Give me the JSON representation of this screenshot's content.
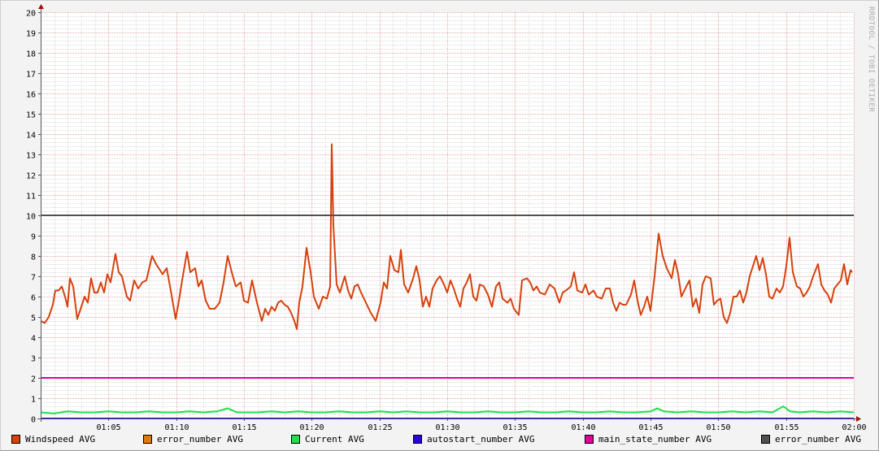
{
  "chart_data": {
    "type": "line",
    "title": "",
    "xlabel": "",
    "ylabel": "",
    "x_unit": "minutes after 01:00",
    "xlim": [
      0,
      60
    ],
    "ylim": [
      0,
      20
    ],
    "y_ticks": [
      0,
      1,
      2,
      3,
      4,
      5,
      6,
      7,
      8,
      9,
      10,
      11,
      12,
      13,
      14,
      15,
      16,
      17,
      18,
      19,
      20
    ],
    "x_ticks": [
      {
        "t": 5,
        "label": "01:05"
      },
      {
        "t": 10,
        "label": "01:10"
      },
      {
        "t": 15,
        "label": "01:15"
      },
      {
        "t": 20,
        "label": "01:20"
      },
      {
        "t": 25,
        "label": "01:25"
      },
      {
        "t": 30,
        "label": "01:30"
      },
      {
        "t": 35,
        "label": "01:35"
      },
      {
        "t": 40,
        "label": "01:40"
      },
      {
        "t": 45,
        "label": "01:45"
      },
      {
        "t": 50,
        "label": "01:50"
      },
      {
        "t": 55,
        "label": "01:55"
      },
      {
        "t": 60,
        "label": "02:00"
      }
    ],
    "grid": true,
    "legend_position": "bottom",
    "watermark": "RRDTOOL / TOBI OETIKER",
    "series": [
      {
        "name": "Windspeed AVG",
        "color": "#d8400c",
        "points": [
          [
            0,
            4.8
          ],
          [
            0.3,
            4.7
          ],
          [
            0.6,
            5.0
          ],
          [
            0.9,
            5.6
          ],
          [
            1.08,
            6.3
          ],
          [
            1.32,
            6.3
          ],
          [
            1.56,
            6.5
          ],
          [
            1.8,
            6.0
          ],
          [
            1.98,
            5.5
          ],
          [
            2.16,
            6.9
          ],
          [
            2.4,
            6.5
          ],
          [
            2.7,
            4.9
          ],
          [
            3.0,
            5.5
          ],
          [
            3.24,
            6.0
          ],
          [
            3.48,
            5.7
          ],
          [
            3.72,
            6.9
          ],
          [
            3.96,
            6.2
          ],
          [
            4.2,
            6.2
          ],
          [
            4.44,
            6.7
          ],
          [
            4.68,
            6.2
          ],
          [
            4.92,
            7.1
          ],
          [
            5.16,
            6.7
          ],
          [
            5.52,
            8.1
          ],
          [
            5.76,
            7.2
          ],
          [
            6.0,
            7.0
          ],
          [
            6.36,
            6.0
          ],
          [
            6.6,
            5.8
          ],
          [
            6.9,
            6.8
          ],
          [
            7.2,
            6.4
          ],
          [
            7.5,
            6.7
          ],
          [
            7.8,
            6.8
          ],
          [
            8.22,
            8.0
          ],
          [
            8.52,
            7.6
          ],
          [
            9.0,
            7.1
          ],
          [
            9.3,
            7.4
          ],
          [
            9.6,
            6.3
          ],
          [
            9.96,
            4.9
          ],
          [
            10.2,
            5.8
          ],
          [
            10.44,
            6.8
          ],
          [
            10.8,
            8.2
          ],
          [
            11.04,
            7.2
          ],
          [
            11.4,
            7.4
          ],
          [
            11.64,
            6.5
          ],
          [
            11.88,
            6.8
          ],
          [
            12.18,
            5.8
          ],
          [
            12.48,
            5.4
          ],
          [
            12.84,
            5.4
          ],
          [
            13.2,
            5.7
          ],
          [
            13.5,
            6.7
          ],
          [
            13.8,
            8.0
          ],
          [
            14.1,
            7.2
          ],
          [
            14.4,
            6.5
          ],
          [
            14.76,
            6.7
          ],
          [
            15.0,
            5.8
          ],
          [
            15.3,
            5.7
          ],
          [
            15.6,
            6.8
          ],
          [
            15.96,
            5.7
          ],
          [
            16.32,
            4.8
          ],
          [
            16.56,
            5.4
          ],
          [
            16.8,
            5.1
          ],
          [
            17.04,
            5.5
          ],
          [
            17.28,
            5.3
          ],
          [
            17.52,
            5.7
          ],
          [
            17.76,
            5.8
          ],
          [
            18.0,
            5.6
          ],
          [
            18.24,
            5.5
          ],
          [
            18.48,
            5.2
          ],
          [
            18.72,
            4.8
          ],
          [
            18.9,
            4.4
          ],
          [
            19.08,
            5.7
          ],
          [
            19.32,
            6.5
          ],
          [
            19.62,
            8.4
          ],
          [
            19.92,
            7.2
          ],
          [
            20.16,
            6.0
          ],
          [
            20.52,
            5.4
          ],
          [
            20.82,
            6.0
          ],
          [
            21.12,
            5.9
          ],
          [
            21.36,
            6.5
          ],
          [
            21.48,
            13.5
          ],
          [
            21.6,
            9.5
          ],
          [
            21.84,
            6.6
          ],
          [
            22.08,
            6.2
          ],
          [
            22.44,
            7.0
          ],
          [
            22.68,
            6.3
          ],
          [
            22.92,
            5.9
          ],
          [
            23.16,
            6.5
          ],
          [
            23.4,
            6.6
          ],
          [
            23.64,
            6.2
          ],
          [
            24.0,
            5.7
          ],
          [
            24.36,
            5.2
          ],
          [
            24.72,
            4.8
          ],
          [
            25.08,
            5.7
          ],
          [
            25.32,
            6.7
          ],
          [
            25.56,
            6.4
          ],
          [
            25.8,
            8.0
          ],
          [
            26.1,
            7.3
          ],
          [
            26.4,
            7.2
          ],
          [
            26.58,
            8.3
          ],
          [
            26.82,
            6.6
          ],
          [
            27.12,
            6.2
          ],
          [
            27.48,
            6.9
          ],
          [
            27.72,
            7.5
          ],
          [
            27.96,
            6.8
          ],
          [
            28.2,
            5.5
          ],
          [
            28.44,
            6.0
          ],
          [
            28.68,
            5.5
          ],
          [
            28.92,
            6.4
          ],
          [
            29.22,
            6.8
          ],
          [
            29.46,
            7.0
          ],
          [
            29.76,
            6.6
          ],
          [
            30.0,
            6.2
          ],
          [
            30.24,
            6.8
          ],
          [
            30.48,
            6.4
          ],
          [
            30.72,
            5.9
          ],
          [
            30.96,
            5.5
          ],
          [
            31.2,
            6.4
          ],
          [
            31.44,
            6.7
          ],
          [
            31.68,
            7.1
          ],
          [
            31.92,
            6.0
          ],
          [
            32.16,
            5.8
          ],
          [
            32.4,
            6.6
          ],
          [
            32.7,
            6.5
          ],
          [
            33.0,
            6.1
          ],
          [
            33.3,
            5.5
          ],
          [
            33.6,
            6.5
          ],
          [
            33.84,
            6.7
          ],
          [
            34.08,
            5.9
          ],
          [
            34.44,
            5.7
          ],
          [
            34.68,
            5.9
          ],
          [
            34.92,
            5.4
          ],
          [
            35.28,
            5.1
          ],
          [
            35.52,
            6.8
          ],
          [
            35.88,
            6.9
          ],
          [
            36.12,
            6.7
          ],
          [
            36.36,
            6.3
          ],
          [
            36.6,
            6.5
          ],
          [
            36.84,
            6.2
          ],
          [
            37.2,
            6.1
          ],
          [
            37.56,
            6.6
          ],
          [
            37.92,
            6.4
          ],
          [
            38.28,
            5.7
          ],
          [
            38.52,
            6.2
          ],
          [
            38.76,
            6.3
          ],
          [
            39.12,
            6.5
          ],
          [
            39.36,
            7.2
          ],
          [
            39.6,
            6.3
          ],
          [
            39.96,
            6.2
          ],
          [
            40.2,
            6.6
          ],
          [
            40.44,
            6.1
          ],
          [
            40.8,
            6.3
          ],
          [
            41.04,
            6.0
          ],
          [
            41.4,
            5.9
          ],
          [
            41.7,
            6.4
          ],
          [
            42.0,
            6.4
          ],
          [
            42.24,
            5.7
          ],
          [
            42.48,
            5.3
          ],
          [
            42.72,
            5.7
          ],
          [
            42.96,
            5.6
          ],
          [
            43.2,
            5.6
          ],
          [
            43.56,
            6.1
          ],
          [
            43.8,
            6.8
          ],
          [
            44.04,
            5.8
          ],
          [
            44.28,
            5.1
          ],
          [
            44.52,
            5.5
          ],
          [
            44.76,
            6.0
          ],
          [
            45.0,
            5.3
          ],
          [
            45.3,
            7.0
          ],
          [
            45.6,
            9.1
          ],
          [
            45.9,
            8.0
          ],
          [
            46.2,
            7.4
          ],
          [
            46.56,
            6.9
          ],
          [
            46.8,
            7.8
          ],
          [
            47.04,
            7.1
          ],
          [
            47.28,
            6.0
          ],
          [
            47.64,
            6.5
          ],
          [
            47.88,
            6.8
          ],
          [
            48.12,
            5.5
          ],
          [
            48.36,
            5.9
          ],
          [
            48.6,
            5.2
          ],
          [
            48.84,
            6.6
          ],
          [
            49.08,
            7.0
          ],
          [
            49.44,
            6.9
          ],
          [
            49.68,
            5.6
          ],
          [
            49.92,
            5.8
          ],
          [
            50.16,
            5.9
          ],
          [
            50.4,
            5.0
          ],
          [
            50.64,
            4.7
          ],
          [
            50.88,
            5.2
          ],
          [
            51.12,
            6.0
          ],
          [
            51.36,
            6.0
          ],
          [
            51.6,
            6.3
          ],
          [
            51.84,
            5.7
          ],
          [
            52.08,
            6.2
          ],
          [
            52.32,
            7.0
          ],
          [
            52.56,
            7.5
          ],
          [
            52.8,
            8.0
          ],
          [
            53.04,
            7.3
          ],
          [
            53.28,
            7.9
          ],
          [
            53.52,
            7.1
          ],
          [
            53.76,
            6.0
          ],
          [
            54.0,
            5.9
          ],
          [
            54.3,
            6.4
          ],
          [
            54.54,
            6.2
          ],
          [
            54.78,
            6.5
          ],
          [
            55.02,
            7.5
          ],
          [
            55.26,
            8.9
          ],
          [
            55.5,
            7.2
          ],
          [
            55.8,
            6.5
          ],
          [
            56.04,
            6.4
          ],
          [
            56.28,
            6.0
          ],
          [
            56.52,
            6.2
          ],
          [
            56.76,
            6.5
          ],
          [
            57.0,
            7.0
          ],
          [
            57.36,
            7.6
          ],
          [
            57.6,
            6.6
          ],
          [
            57.84,
            6.3
          ],
          [
            58.08,
            6.1
          ],
          [
            58.32,
            5.7
          ],
          [
            58.56,
            6.4
          ],
          [
            58.8,
            6.6
          ],
          [
            59.04,
            6.8
          ],
          [
            59.28,
            7.6
          ],
          [
            59.52,
            6.6
          ],
          [
            59.76,
            7.3
          ],
          [
            59.88,
            7.2
          ]
        ]
      },
      {
        "name": "error_number AVG",
        "color": "#e07a00",
        "points": []
      },
      {
        "name": "Current AVG",
        "color": "#1ee04a",
        "points": [
          [
            0,
            0.3
          ],
          [
            1,
            0.25
          ],
          [
            2,
            0.35
          ],
          [
            3,
            0.3
          ],
          [
            4,
            0.3
          ],
          [
            5,
            0.35
          ],
          [
            6,
            0.3
          ],
          [
            7,
            0.3
          ],
          [
            8,
            0.35
          ],
          [
            9,
            0.3
          ],
          [
            10,
            0.3
          ],
          [
            11,
            0.35
          ],
          [
            12,
            0.3
          ],
          [
            13,
            0.35
          ],
          [
            13.8,
            0.5
          ],
          [
            14.5,
            0.3
          ],
          [
            15,
            0.3
          ],
          [
            16,
            0.3
          ],
          [
            17,
            0.35
          ],
          [
            18,
            0.3
          ],
          [
            19,
            0.35
          ],
          [
            20,
            0.3
          ],
          [
            21,
            0.3
          ],
          [
            22,
            0.35
          ],
          [
            23,
            0.3
          ],
          [
            24,
            0.3
          ],
          [
            25,
            0.35
          ],
          [
            26,
            0.3
          ],
          [
            27,
            0.35
          ],
          [
            28,
            0.3
          ],
          [
            29,
            0.3
          ],
          [
            30,
            0.35
          ],
          [
            31,
            0.3
          ],
          [
            32,
            0.3
          ],
          [
            33,
            0.35
          ],
          [
            34,
            0.3
          ],
          [
            35,
            0.3
          ],
          [
            36,
            0.35
          ],
          [
            37,
            0.3
          ],
          [
            38,
            0.3
          ],
          [
            39,
            0.35
          ],
          [
            40,
            0.3
          ],
          [
            41,
            0.3
          ],
          [
            42,
            0.35
          ],
          [
            43,
            0.3
          ],
          [
            44,
            0.3
          ],
          [
            45,
            0.35
          ],
          [
            45.5,
            0.5
          ],
          [
            46,
            0.35
          ],
          [
            47,
            0.3
          ],
          [
            48,
            0.35
          ],
          [
            49,
            0.3
          ],
          [
            50,
            0.3
          ],
          [
            51,
            0.35
          ],
          [
            52,
            0.3
          ],
          [
            53,
            0.35
          ],
          [
            54,
            0.3
          ],
          [
            54.8,
            0.6
          ],
          [
            55.3,
            0.35
          ],
          [
            56,
            0.3
          ],
          [
            57,
            0.35
          ],
          [
            58,
            0.3
          ],
          [
            59,
            0.35
          ],
          [
            60,
            0.3
          ]
        ]
      },
      {
        "name": "autostart_number AVG",
        "color": "#2a00e0",
        "points": [
          [
            0,
            0
          ],
          [
            60,
            0
          ]
        ]
      },
      {
        "name": "main_state_number AVG",
        "color": "#e000a0",
        "points": [
          [
            0,
            2
          ],
          [
            60,
            2
          ]
        ]
      },
      {
        "name": "error_number AVG",
        "color": "#505050",
        "points": [
          [
            0,
            10
          ],
          [
            60,
            10
          ]
        ]
      }
    ]
  }
}
